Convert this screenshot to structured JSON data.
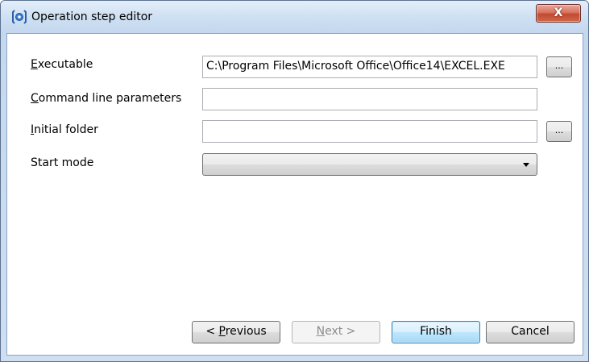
{
  "window": {
    "title": "Operation step editor",
    "close_label": "X"
  },
  "form": {
    "executable": {
      "label_accel": "E",
      "label_rest": "xecutable",
      "value": "C:\\Program Files\\Microsoft Office\\Office14\\EXCEL.EXE",
      "browse_label": "..."
    },
    "command_line": {
      "label_accel": "C",
      "label_rest": "ommand line parameters",
      "value": ""
    },
    "initial_folder": {
      "label_accel": "I",
      "label_rest": "nitial folder",
      "value": "",
      "browse_label": "..."
    },
    "start_mode": {
      "label": "Start mode",
      "selected": ""
    }
  },
  "buttons": {
    "previous_prefix": "< ",
    "previous_accel": "P",
    "previous_rest": "revious",
    "next_accel": "N",
    "next_rest": "ext >",
    "finish": "Finish",
    "cancel": "Cancel"
  }
}
